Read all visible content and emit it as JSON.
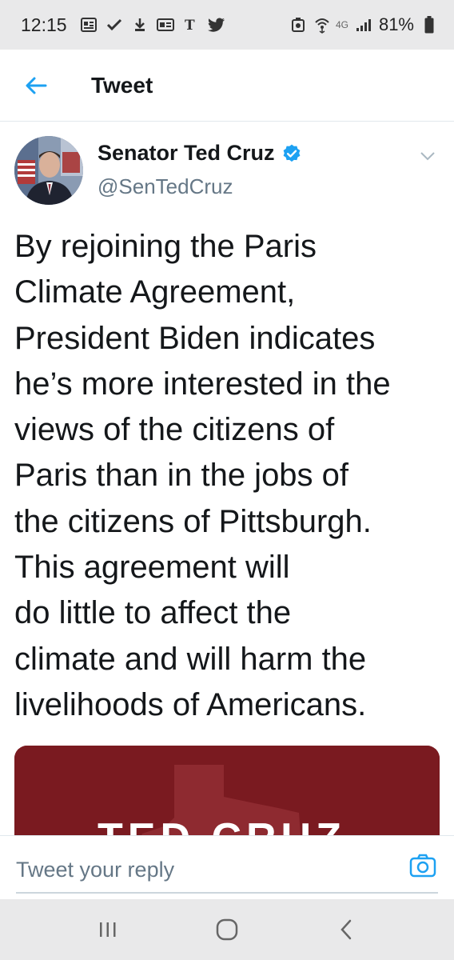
{
  "status_bar": {
    "time": "12:15",
    "network": "4G",
    "battery": "81%",
    "icons": [
      "news-icon",
      "check-icon",
      "download-icon",
      "browser-icon",
      "nyt-icon",
      "twitter-icon",
      "photo-icon",
      "hotspot-icon",
      "signal-icon",
      "battery-icon"
    ]
  },
  "header": {
    "title": "Tweet",
    "back_icon": "arrow-left-icon"
  },
  "tweet": {
    "author_name": "Senator Ted Cruz",
    "handle": "@SenTedCruz",
    "verified": true,
    "text": "By rejoining the Paris\nClimate Agreement,\nPresident Biden indicates\nhe’s more interested in the\nviews of the citizens of\nParis than in the jobs of\nthe citizens of Pittsburgh.\nThis agreement will\ndo little to affect the\nclimate and will harm the\nlivelihoods of Americans.",
    "media_title": "TED CRUZ"
  },
  "reply": {
    "placeholder": "Tweet your reply"
  },
  "colors": {
    "accent": "#1da1f2",
    "text": "#14171a",
    "secondary": "#657786",
    "media_bg": "#7a1a20"
  }
}
